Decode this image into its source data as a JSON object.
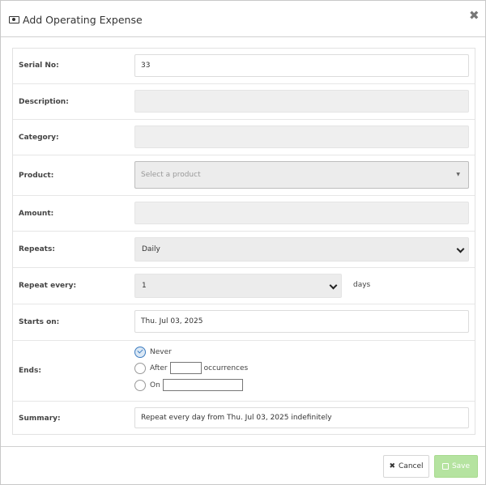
{
  "header": {
    "title": "Add Operating Expense",
    "icon": "money-icon",
    "close_label": "✖"
  },
  "form": {
    "serial": {
      "label": "Serial No:",
      "value": "33"
    },
    "description": {
      "label": "Description:",
      "value": ""
    },
    "category": {
      "label": "Category:",
      "value": ""
    },
    "product": {
      "label": "Product:",
      "placeholder": "Select a product",
      "caret": "▼"
    },
    "amount": {
      "label": "Amount:",
      "value": ""
    },
    "repeats": {
      "label": "Repeats:",
      "value": "Daily"
    },
    "repeat_every": {
      "label": "Repeat every:",
      "value": "1",
      "unit": "days"
    },
    "starts_on": {
      "label": "Starts on:",
      "value": "Thu. Jul 03, 2025"
    },
    "ends": {
      "label": "Ends:",
      "options": {
        "never": "Never",
        "after": "After",
        "after_suffix": "occurrences",
        "on": "On"
      },
      "selected": "never"
    },
    "summary": {
      "label": "Summary:",
      "value": "Repeat every day from Thu. Jul 03, 2025 indefinitely"
    }
  },
  "footer": {
    "cancel_label": "Cancel",
    "save_label": "Save",
    "cancel_icon": "✖"
  },
  "colors": {
    "save_bg": "#b5e3a0",
    "radio_checked": "#3b7bbf"
  }
}
